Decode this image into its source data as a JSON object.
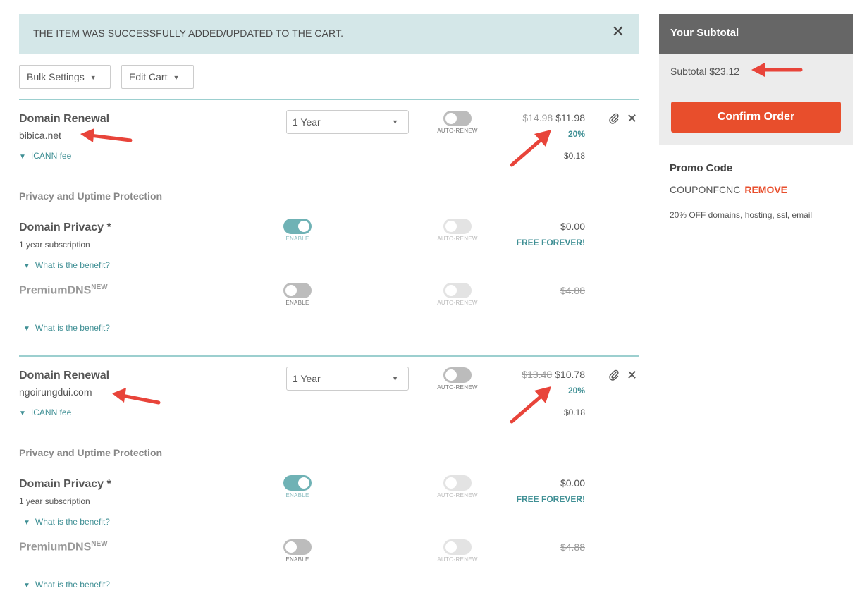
{
  "banner": {
    "message": "THE ITEM WAS SUCCESSFULLY ADDED/UPDATED TO THE CART.",
    "close": "✕"
  },
  "toolbar": {
    "bulk_label": "Bulk Settings",
    "edit_label": "Edit Cart"
  },
  "items": [
    {
      "title": "Domain Renewal",
      "domain": "bibica.net",
      "icann_label": "ICANN fee",
      "term": "1 Year",
      "auto_renew_label": "AUTO-RENEW",
      "old_price": "$14.98",
      "price": "$11.98",
      "discount": "20%",
      "icann_fee": "$0.18",
      "section_label": "Privacy and Uptime Protection",
      "privacy": {
        "title": "Domain Privacy *",
        "sub": "1 year subscription",
        "benefit": "What is the benefit?",
        "enable_label": "ENABLE",
        "auto_label": "AUTO-RENEW",
        "price": "$0.00",
        "note": "FREE FOREVER!"
      },
      "dns": {
        "title": "PremiumDNS",
        "badge": "NEW",
        "benefit": "What is the benefit?",
        "enable_label": "ENABLE",
        "auto_label": "AUTO-RENEW",
        "price": "$4.88"
      }
    },
    {
      "title": "Domain Renewal",
      "domain": "ngoirungdui.com",
      "icann_label": "ICANN fee",
      "term": "1 Year",
      "auto_renew_label": "AUTO-RENEW",
      "old_price": "$13.48",
      "price": "$10.78",
      "discount": "20%",
      "icann_fee": "$0.18",
      "section_label": "Privacy and Uptime Protection",
      "privacy": {
        "title": "Domain Privacy *",
        "sub": "1 year subscription",
        "benefit": "What is the benefit?",
        "enable_label": "ENABLE",
        "auto_label": "AUTO-RENEW",
        "price": "$0.00",
        "note": "FREE FOREVER!"
      },
      "dns": {
        "title": "PremiumDNS",
        "badge": "NEW",
        "benefit": "What is the benefit?",
        "enable_label": "ENABLE",
        "auto_label": "AUTO-RENEW",
        "price": "$4.88"
      }
    }
  ],
  "sidebar": {
    "heading": "Your Subtotal",
    "subtotal": "Subtotal $23.12",
    "confirm_label": "Confirm Order"
  },
  "promo": {
    "heading": "Promo Code",
    "code": "COUPONFCNC",
    "remove_label": "REMOVE",
    "description": "20% OFF domains, hosting, ssl, email"
  },
  "colors": {
    "accent": "#3f8f94",
    "confirm": "#e84e2c",
    "banner_bg": "#d4e7e8",
    "arrow": "#e8443a"
  }
}
